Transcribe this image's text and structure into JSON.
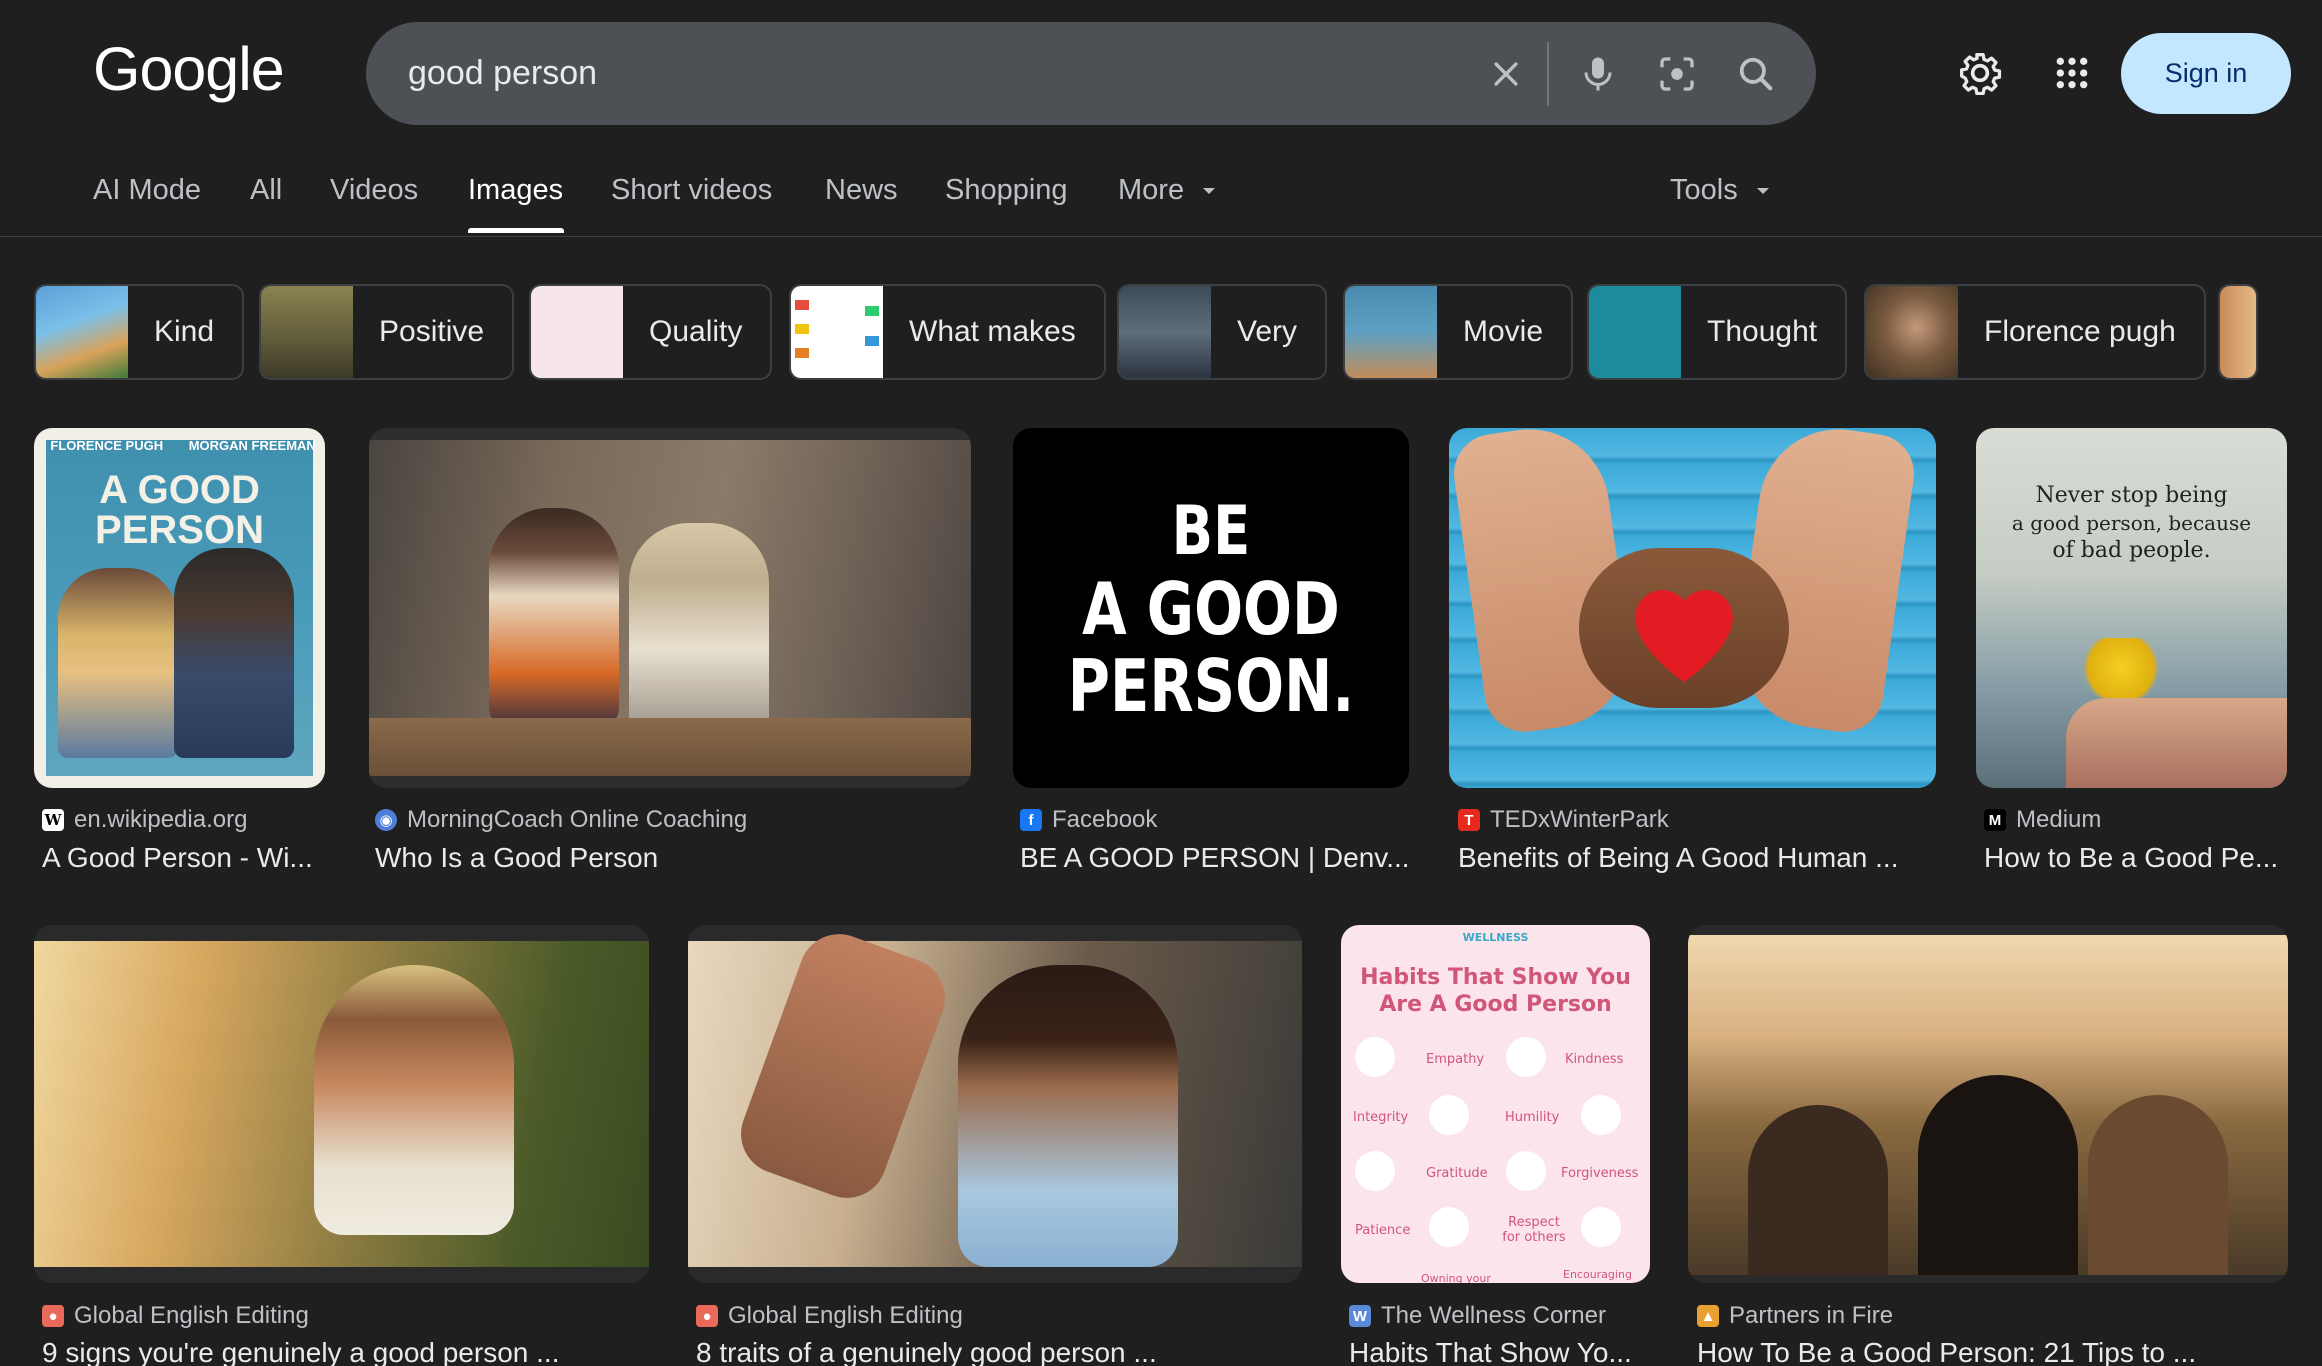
{
  "header": {
    "logo_text": "Google",
    "search_value": "good person",
    "sign_in_label": "Sign in",
    "accent": "#c2e7ff"
  },
  "tabs": [
    "AI Mode",
    "All",
    "Videos",
    "Images",
    "Short videos",
    "News",
    "Shopping",
    "More"
  ],
  "tools_label": "Tools",
  "chips": [
    "Kind",
    "Positive",
    "Quality",
    "What makes",
    "Very",
    "Movie",
    "Thought",
    "Florence pugh"
  ],
  "results": [
    {
      "source": "en.wikipedia.org",
      "title": "A Good Person - Wi..."
    },
    {
      "source": "MorningCoach Online Coaching",
      "title": "Who Is a Good Person"
    },
    {
      "source": "Facebook",
      "title": "BE A GOOD PERSON | Denv..."
    },
    {
      "source": "TEDxWinterPark",
      "title": "Benefits of Being A Good Human ..."
    },
    {
      "source": "Medium",
      "title": "How to Be a Good Pe..."
    },
    {
      "source": "Global English Editing",
      "title": "9 signs you're genuinely a good person ..."
    },
    {
      "source": "Global English Editing",
      "title": "8 traits of a genuinely good person ..."
    },
    {
      "source": "The Wellness Corner",
      "title": "Habits That Show Yo..."
    },
    {
      "source": "Partners in Fire",
      "title": "How To Be a Good Person: 21 Tips to ..."
    }
  ],
  "image_text": {
    "poster_top_left": "FLORENCE PUGH",
    "poster_top_right": "MORGAN FREEMAN",
    "poster_title_1": "A GOOD",
    "poster_title_2": "PERSON",
    "bagp_line1": "BE",
    "bagp_line2": "A GOOD",
    "bagp_line3": "PERSON.",
    "quote_line1": "Never stop being",
    "quote_line2": "a good person, because",
    "quote_line3": "of bad people.",
    "infographic_brand": "WELLNESS",
    "infographic_title_1": "Habits That Show You",
    "infographic_title_2": "Are A Good Person",
    "infographic_cells": [
      "Empathy",
      "Kindness",
      "Integrity",
      "Humility",
      "Gratitude",
      "Forgiveness",
      "Patience",
      "Respect for others",
      "Owning your",
      "Encouraging"
    ]
  }
}
